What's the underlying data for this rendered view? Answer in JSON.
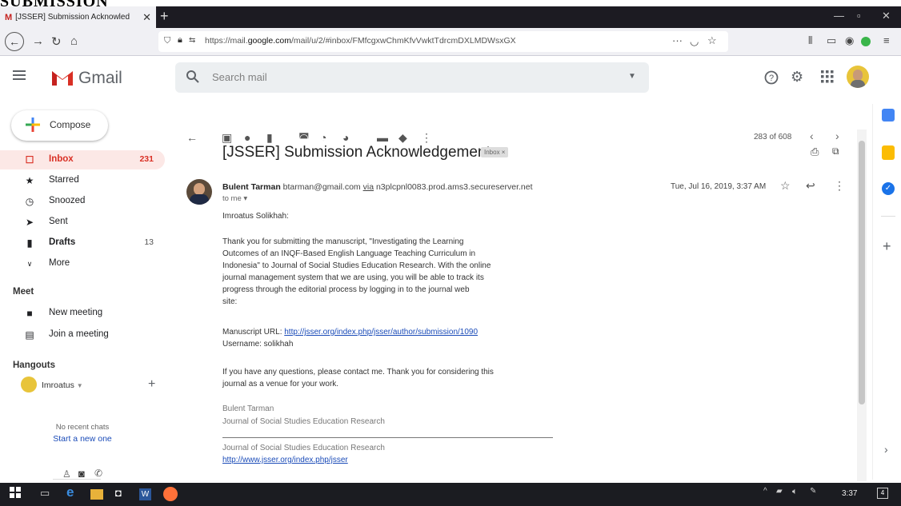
{
  "crop_title": "SUBMISSION",
  "browser": {
    "tab_title": "[JSSER] Submission Acknowled",
    "url_prefix": "https://mail.",
    "url_domain": "google.com",
    "url_rest": "/mail/u/2/#inbox/FMfcgxwChmKfvVwktTdrcmDXLMDWsxGX",
    "menu_dots": "···"
  },
  "gmail": {
    "app_name": "Gmail",
    "search_placeholder": "Search mail",
    "compose_label": "Compose",
    "nav": [
      {
        "label": "Inbox",
        "count": "231"
      },
      {
        "label": "Starred",
        "count": ""
      },
      {
        "label": "Snoozed",
        "count": ""
      },
      {
        "label": "Sent",
        "count": ""
      },
      {
        "label": "Drafts",
        "count": "13"
      },
      {
        "label": "More",
        "count": ""
      }
    ],
    "meet": {
      "title": "Meet",
      "new_meeting": "New meeting",
      "join_meeting": "Join a meeting"
    },
    "hangouts": {
      "title": "Hangouts",
      "user": "Imroatus",
      "no_chats": "No recent chats",
      "start_new": "Start a new one"
    },
    "pager": "283 of 608"
  },
  "email": {
    "subject": "[JSSER] Submission Acknowledgement",
    "label": "Inbox",
    "sender_name": "Bulent Tarman",
    "sender_email": "btarman@gmail.com",
    "via_word": "via",
    "via_server": "n3plcpnl0083.prod.ams3.secureserver.net",
    "to": "to me",
    "date": "Tue, Jul 16, 2019, 3:37 AM",
    "greeting": "Imroatus Solikhah:",
    "para1_lines": [
      "Thank you for submitting the manuscript, \"Investigating the Learning",
      "Outcomes of an INQF-Based  English Language Teaching Curriculum in",
      "Indonesia\" to Journal of Social Studies Education Research. With the online",
      "journal management system that we are using, you will be able to track its",
      "progress through the editorial process by logging in to the journal web",
      "site:"
    ],
    "url_label": "Manuscript URL: ",
    "url_link": "http://jsser.org/index.php/jsser/author/submission/1090",
    "username_line": "Username: solikhah",
    "para2_lines": [
      "If you have any questions, please contact me. Thank you for considering this",
      "journal as a venue for your work."
    ],
    "sig_name": "Bulent Tarman",
    "sig_journal": "Journal of Social Studies Education Research",
    "footer_journal": "Journal of Social Studies Education Research",
    "footer_link": "http://www.jsser.org/index.php/jsser"
  },
  "taskbar": {
    "time": "3:37",
    "notify_count": "4"
  },
  "colors": {
    "gmail_red": "#d93025",
    "inbox_bg": "#fce8e6",
    "link": "#1a4bb8"
  }
}
